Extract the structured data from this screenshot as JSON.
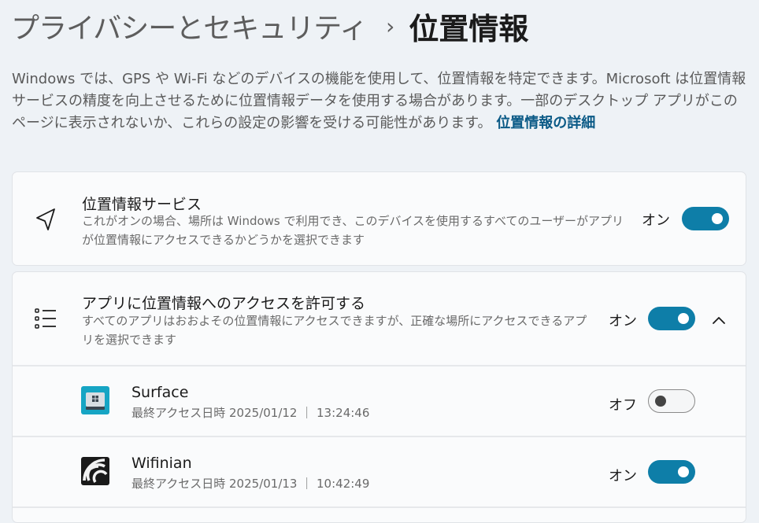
{
  "breadcrumb": {
    "parent": "プライバシーとセキュリティ",
    "separator": "›",
    "current": "位置情報"
  },
  "intro": {
    "text": "Windows では、GPS や Wi-Fi などのデバイスの機能を使用して、位置情報を特定できます。Microsoft は位置情報サービスの精度を向上させるために位置情報データを使用する場合があります。一部のデスクトップ アプリがこのページに表示されないか、これらの設定の影響を受ける可能性があります。",
    "link": "位置情報の詳細"
  },
  "location_services": {
    "title": "位置情報サービス",
    "description": "これがオンの場合、場所は Windows で利用でき、このデバイスを使用するすべてのユーザーがアプリが位置情報にアクセスできるかどうかを選択できます",
    "state_label": "オン",
    "enabled": true
  },
  "app_access": {
    "title": "アプリに位置情報へのアクセスを許可する",
    "description": "すべてのアプリはおおよその位置情報にアクセスできますが、正確な場所にアクセスできるアプリを選択できます",
    "state_label": "オン",
    "enabled": true,
    "expanded": true
  },
  "apps": [
    {
      "name": "Surface",
      "last_access": "最終アクセス日時 2025/01/12 ｜ 13:24:46",
      "state_label": "オフ",
      "enabled": false,
      "icon": "surface-app-icon"
    },
    {
      "name": "Wifinian",
      "last_access": "最終アクセス日時 2025/01/13 ｜ 10:42:49",
      "state_label": "オン",
      "enabled": true,
      "icon": "wifinian-app-icon"
    }
  ],
  "colors": {
    "accent": "#0e7ea8",
    "link": "#0b5a86",
    "background": "#eef2f6"
  }
}
